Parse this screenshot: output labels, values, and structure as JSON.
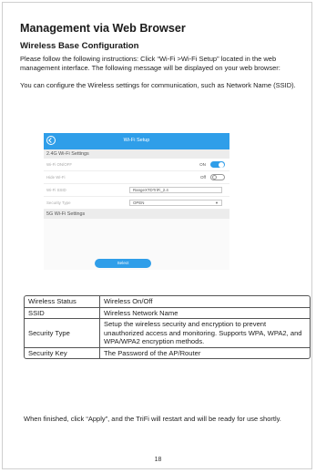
{
  "title": "Management via Web Browser",
  "subtitle": "Wireless Base Configuration",
  "intro": "Please follow the following instructions: Click “Wi-Fi >Wi-Fi Setup” located in the web management interface. The following message will be displayed on your web browser:",
  "para2": "You can configure the Wireless settings for communication, such as Network Name (SSID).",
  "screenshot": {
    "header_title": "Wi-Fi Setup",
    "section_24": "2.4G Wi-Fi Settings",
    "rows": [
      {
        "label": "Wi-Fi ON/OFF",
        "value": "ON"
      },
      {
        "label": "Hide Wi-Fi",
        "value": "Off"
      },
      {
        "label": "Wi-Fi SSID",
        "value": "RangeXTDTriFi_2.4"
      },
      {
        "label": "Security Type",
        "value": "OPEN"
      }
    ],
    "section_5": "5G Wi-Fi Settings",
    "button": "Select"
  },
  "table": [
    {
      "key": "Wireless Status",
      "value": "Wireless On/Off"
    },
    {
      "key": "SSID",
      "value": "Wireless Network Name"
    },
    {
      "key": "Security Type",
      "value": "Setup the wireless security and encryption to prevent unauthorized access and monitoring. Supports WPA, WPA2, and WPA/WPA2 encryption methods."
    },
    {
      "key": "Security Key",
      "value": "The Password of the AP/Router"
    }
  ],
  "outro": "When finished, click “Apply”, and the TriFi will restart and will be ready for use shortly.",
  "page_number": "18",
  "colors": {
    "accent": "#2f9ee9"
  }
}
